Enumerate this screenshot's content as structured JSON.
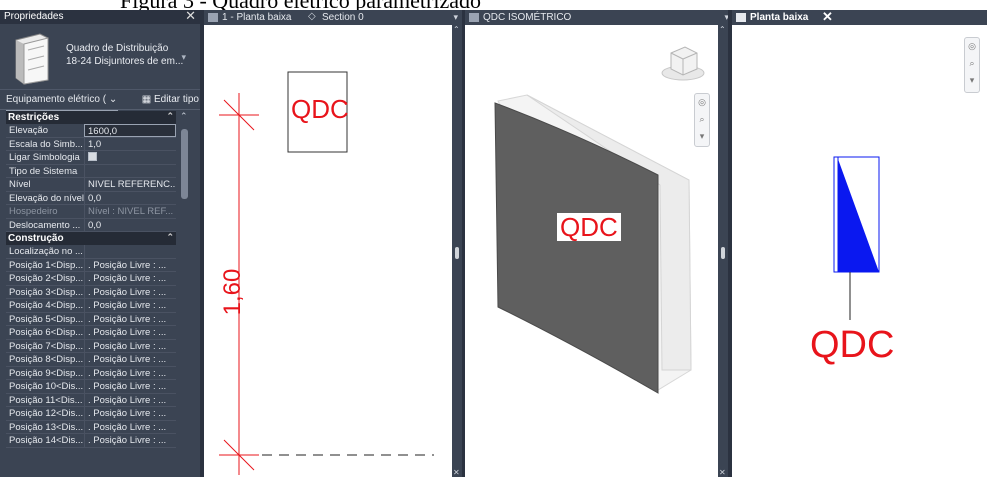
{
  "caption": "Figura 3 - Quadro elétrico parametrizado",
  "properties": {
    "title": "Propriedades",
    "type_name_line1": "Quadro de Distribuição",
    "type_name_line2": "18-24 Disjuntores de em...",
    "category_select": "Equipamento elétrico (",
    "edit_type": "Editar tipo",
    "sections": [
      {
        "name": "Restrições",
        "rows": [
          {
            "k": "Elevação",
            "v": "1600,0"
          },
          {
            "k": "Escala do Simb...",
            "v": "1,0"
          },
          {
            "k": "Ligar Simbologia",
            "v": ""
          },
          {
            "k": "Tipo de Sistema",
            "v": ""
          },
          {
            "k": "Nível",
            "v": "NIVEL REFERENC..."
          },
          {
            "k": "Elevação do nível",
            "v": "0,0"
          },
          {
            "k": "Hospedeiro",
            "v": "Nível : NIVEL REF..."
          },
          {
            "k": "Deslocamento ...",
            "v": "0,0"
          }
        ]
      },
      {
        "name": "Construção",
        "rows": [
          {
            "k": "Localização no ...",
            "v": ""
          },
          {
            "k": "Posição 1<Disp...",
            "v": ". Posição Livre : ..."
          },
          {
            "k": "Posição 2<Disp...",
            "v": ". Posição Livre : ..."
          },
          {
            "k": "Posição 3<Disp...",
            "v": ". Posição Livre : ..."
          },
          {
            "k": "Posição 4<Disp...",
            "v": ". Posição Livre : ..."
          },
          {
            "k": "Posição 5<Disp...",
            "v": ". Posição Livre : ..."
          },
          {
            "k": "Posição 6<Disp...",
            "v": ". Posição Livre : ..."
          },
          {
            "k": "Posição 7<Disp...",
            "v": ". Posição Livre : ..."
          },
          {
            "k": "Posição 8<Disp...",
            "v": ". Posição Livre : ..."
          },
          {
            "k": "Posição 9<Disp...",
            "v": ". Posição Livre : ..."
          },
          {
            "k": "Posição 10<Dis...",
            "v": ". Posição Livre : ..."
          },
          {
            "k": "Posição 11<Dis...",
            "v": ". Posição Livre : ..."
          },
          {
            "k": "Posição 12<Dis...",
            "v": ". Posição Livre : ..."
          },
          {
            "k": "Posição 13<Dis...",
            "v": ". Posição Livre : ..."
          },
          {
            "k": "Posição 14<Dis...",
            "v": ". Posição Livre : ..."
          }
        ]
      }
    ]
  },
  "views": {
    "left_tabs": [
      "1 - Planta baixa",
      "Section 0"
    ],
    "iso_tab": "QDC ISOMÉTRICO",
    "plan_tab": "Planta baixa",
    "tag": "QDC",
    "dimension": "1,60"
  },
  "colors": {
    "panel_bg": "#3b4453",
    "annotation_red": "#e8141b",
    "symbol_blue": "#0a18f0",
    "box_gray": "#5f5f5f"
  }
}
